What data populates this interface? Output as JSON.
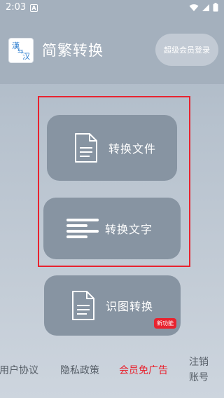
{
  "status": {
    "time": "2:03",
    "app_icon_letter": "A"
  },
  "header": {
    "logo_chars": [
      "漢",
      "汉"
    ],
    "title": "简繁转换",
    "vip_login": "超级会员登录"
  },
  "actions": {
    "file_label": "转换文件",
    "text_label": "转换文字",
    "ocr_label": "识图转换",
    "ocr_badge": "新功能"
  },
  "footer": {
    "user_agreement": "用户协议",
    "privacy_policy": "隐私政策",
    "vip_no_ads": "会员免广告",
    "cancel_account": "注销账号"
  },
  "colors": {
    "accent_red": "#e8232f",
    "button_gray": "#8794a2",
    "header_bg": "#a4b0bd"
  },
  "icons": [
    "wifi-icon",
    "signal-icon",
    "battery-icon",
    "document-icon",
    "text-lines-icon"
  ]
}
